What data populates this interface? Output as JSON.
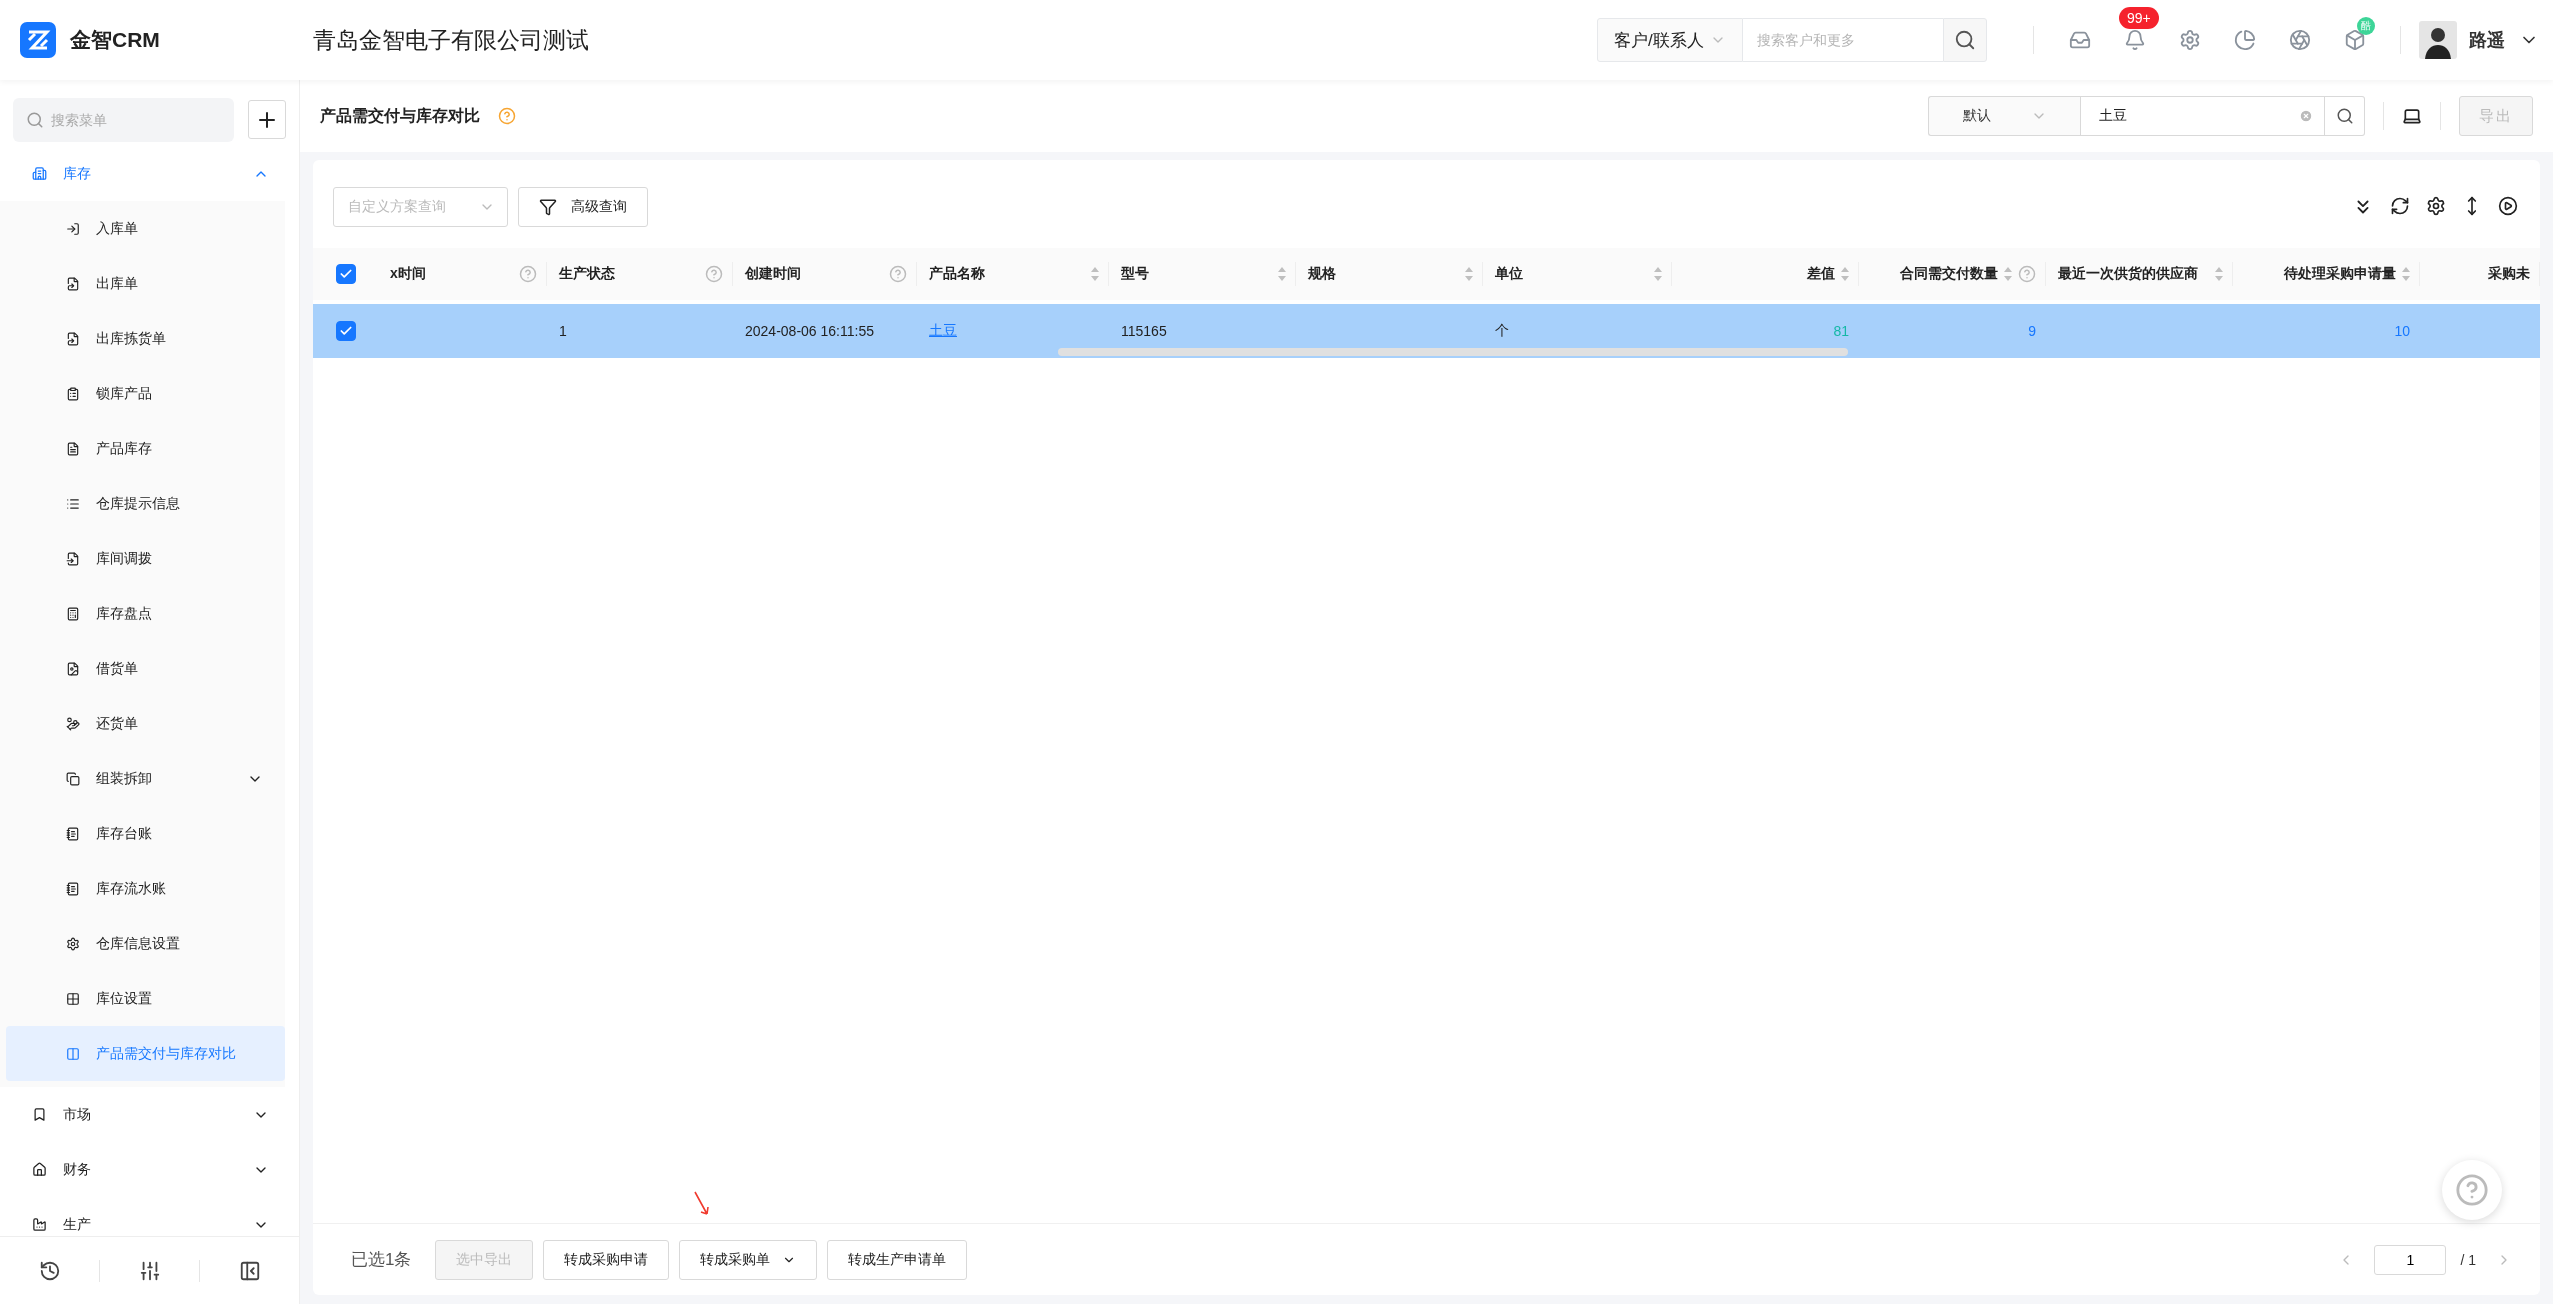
{
  "app": {
    "logo_text": "金智CRM",
    "company": "青岛金智电子有限公司测试"
  },
  "header_search": {
    "scope": "客户/联系人",
    "placeholder": "搜索客户和更多"
  },
  "notifications_badge": "99+",
  "plugin_badge": "酷",
  "user": {
    "name": "路遥"
  },
  "sidebar": {
    "search_placeholder": "搜索菜单",
    "items": [
      {
        "label": "库存",
        "expanded": true,
        "children": [
          {
            "label": "入库单",
            "selected": false
          },
          {
            "label": "出库单",
            "selected": false
          },
          {
            "label": "出库拣货单",
            "selected": false
          },
          {
            "label": "锁库产品",
            "selected": false
          },
          {
            "label": "产品库存",
            "selected": false
          },
          {
            "label": "仓库提示信息",
            "selected": false
          },
          {
            "label": "库间调拨",
            "selected": false
          },
          {
            "label": "库存盘点",
            "selected": false
          },
          {
            "label": "借货单",
            "selected": false
          },
          {
            "label": "还货单",
            "selected": false
          },
          {
            "label": "组装拆卸",
            "selected": false,
            "expanded": false
          },
          {
            "label": "库存台账",
            "selected": false
          },
          {
            "label": "库存流水账",
            "selected": false
          },
          {
            "label": "仓库信息设置",
            "selected": false
          },
          {
            "label": "库位设置",
            "selected": false
          },
          {
            "label": "产品需交付与库存对比",
            "selected": true
          }
        ]
      },
      {
        "label": "市场",
        "expanded": false
      },
      {
        "label": "财务",
        "expanded": false
      },
      {
        "label": "生产",
        "expanded": false
      }
    ]
  },
  "page": {
    "title": "产品需交付与库存对比",
    "view": "默认",
    "search_value": "土豆",
    "export": "导出"
  },
  "toolbar": {
    "scheme_placeholder": "自定义方案查询",
    "advanced": "高级查询"
  },
  "table": {
    "all_checked": true,
    "columns": [
      {
        "label": "x时间",
        "help": true,
        "sortable": false,
        "kind": "text"
      },
      {
        "label": "生产状态",
        "help": true,
        "sortable": false,
        "kind": "text"
      },
      {
        "label": "创建时间",
        "help": true,
        "sortable": false,
        "kind": "text"
      },
      {
        "label": "产品名称",
        "help": false,
        "sortable": true,
        "kind": "link"
      },
      {
        "label": "型号",
        "help": false,
        "sortable": true,
        "kind": "text"
      },
      {
        "label": "规格",
        "help": false,
        "sortable": true,
        "kind": "text"
      },
      {
        "label": "单位",
        "help": false,
        "sortable": true,
        "kind": "text"
      },
      {
        "label": "差值",
        "help": false,
        "sortable": true,
        "kind": "positive"
      },
      {
        "label": "合同需交付数量",
        "help": true,
        "sortable": true,
        "kind": "count"
      },
      {
        "label": "最近一次供货的供应商",
        "help": false,
        "sortable": true,
        "kind": "text"
      },
      {
        "label": "待处理采购申请量",
        "help": false,
        "sortable": true,
        "kind": "count"
      },
      {
        "label": "采购未",
        "help": false,
        "sortable": false,
        "kind": "count"
      }
    ],
    "rows": [
      {
        "selected": true,
        "cells": [
          null,
          "1",
          "2024-08-06 16:11:55",
          "土豆",
          "115165",
          null,
          "个",
          "81",
          "9",
          null,
          "10",
          null
        ]
      }
    ]
  },
  "footer": {
    "selected_count": "已选1条",
    "buttons": [
      {
        "label": "选中导出",
        "disabled": true
      },
      {
        "label": "转成采购申请",
        "disabled": false
      },
      {
        "label": "转成采购单",
        "disabled": false,
        "dropdown": true
      },
      {
        "label": "转成生产申请单",
        "disabled": false
      }
    ],
    "pagination": {
      "page": "1",
      "total": "/ 1"
    }
  }
}
